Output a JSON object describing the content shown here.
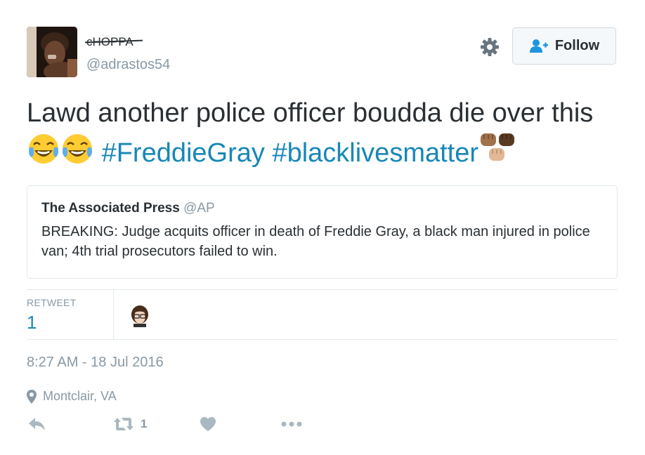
{
  "user": {
    "display_name": "cHOPPA",
    "screen_name": "@adrastos54",
    "avatar_icon": "user-avatar"
  },
  "follow_button": {
    "label": "Follow",
    "icon": "follow-user-icon"
  },
  "settings_icon": "gear-icon",
  "tweet": {
    "text": "Lawd another police officer boudda die over this",
    "emojis": [
      "face-with-tears-of-joy",
      "face-with-tears-of-joy"
    ],
    "hashtags": [
      "#FreddieGray",
      "#blacklivesmatter"
    ],
    "trailing_emoji": "raised-fists"
  },
  "quoted_tweet": {
    "name": "The Associated Press",
    "handle": "@AP",
    "text": "BREAKING: Judge acquits officer in death of Freddie Gray, a black man injured in police van; 4th trial prosecutors failed to win."
  },
  "stats": {
    "retweet_label": "RETWEET",
    "retweet_count": "1"
  },
  "timestamp": "8:27 AM - 18 Jul 2016",
  "location": "Montclair, VA",
  "actions": {
    "retweet_count": "1"
  },
  "colors": {
    "text": "#292f33",
    "secondary": "#8899a6",
    "link": "#1887b8",
    "border": "#e1e8ed"
  }
}
